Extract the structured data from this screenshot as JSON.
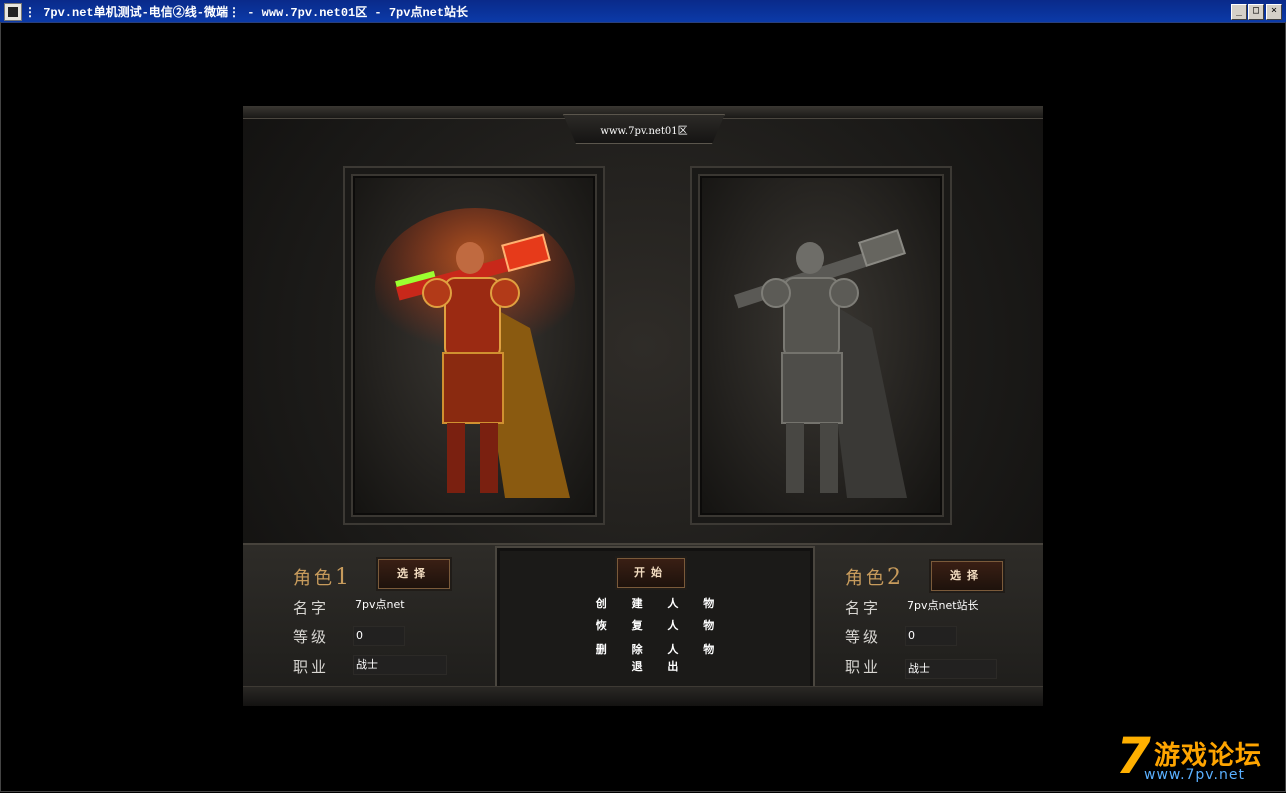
{
  "window": {
    "title": "⋮ 7pv.net单机测试-电信②线-微端⋮ - www.7pv.net01区 - 7pv点net站长",
    "minimize": "_",
    "maximize": "□",
    "close": "×"
  },
  "game": {
    "server_label": "www.7pv.net01区",
    "slot1": {
      "title_prefix": "角色",
      "number": "1",
      "select_button": "选择",
      "name_label": "名字",
      "name_value": "7pv点net",
      "level_label": "等级",
      "level_value": "0",
      "class_label": "职业",
      "class_value": "战士"
    },
    "slot2": {
      "title_prefix": "角色",
      "number": "2",
      "select_button": "选择",
      "name_label": "名字",
      "name_value": "7pv点net站长",
      "level_label": "等级",
      "level_value": "0",
      "class_label": "职业",
      "class_value": "战士"
    },
    "center": {
      "start_button": "开始",
      "create": [
        "创",
        "建",
        "人",
        "物"
      ],
      "restore": [
        "恢",
        "复",
        "人",
        "物"
      ],
      "delete": [
        "删",
        "除",
        "人",
        "物"
      ],
      "exit": [
        "退",
        "出"
      ]
    }
  },
  "watermark": {
    "seven": "7",
    "title": "游戏论坛",
    "url": "www.7pv.net"
  },
  "colors": {
    "titlebar": "#0a2a8a",
    "gold": "#c79b5c",
    "watermark_orange": "#ffa500",
    "watermark_blue": "#5ab0ff"
  }
}
